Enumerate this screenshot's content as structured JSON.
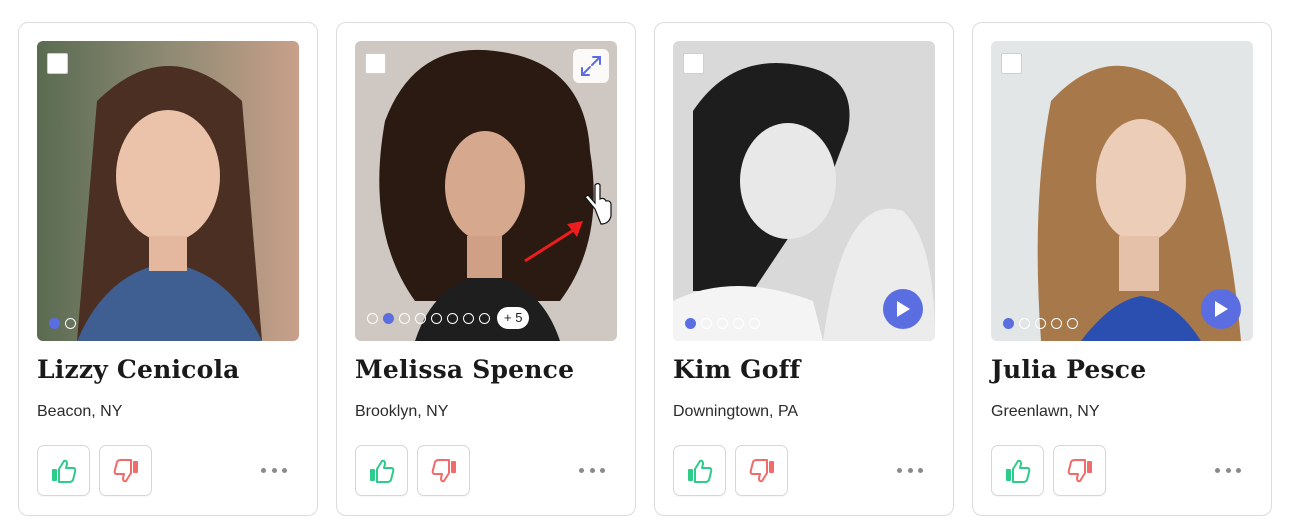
{
  "colors": {
    "accent": "#5b6ee1",
    "like": "#2ecc8a",
    "dislike": "#f26b6b",
    "border": "#dcdcdc"
  },
  "cards": [
    {
      "name": "Lizzy Cenicola",
      "location": "Beacon, NY",
      "photo_count": 2,
      "active_photo": 0,
      "extra_photos_label": "",
      "has_video": false,
      "has_expand": false
    },
    {
      "name": "Melissa Spence",
      "location": "Brooklyn, NY",
      "photo_count": 8,
      "active_photo": 1,
      "extra_photos_label": "+ 5",
      "has_video": false,
      "has_expand": true
    },
    {
      "name": "Kim Goff",
      "location": "Downingtown, PA",
      "photo_count": 5,
      "active_photo": 0,
      "extra_photos_label": "",
      "has_video": true,
      "has_expand": false
    },
    {
      "name": "Julia Pesce",
      "location": "Greenlawn, NY",
      "photo_count": 5,
      "active_photo": 0,
      "extra_photos_label": "",
      "has_video": true,
      "has_expand": false
    }
  ],
  "icons": {
    "select": "checkbox-icon",
    "expand": "expand-icon",
    "play": "play-icon",
    "like": "thumbs-up-icon",
    "dislike": "thumbs-down-icon",
    "more": "more-horizontal-icon"
  }
}
